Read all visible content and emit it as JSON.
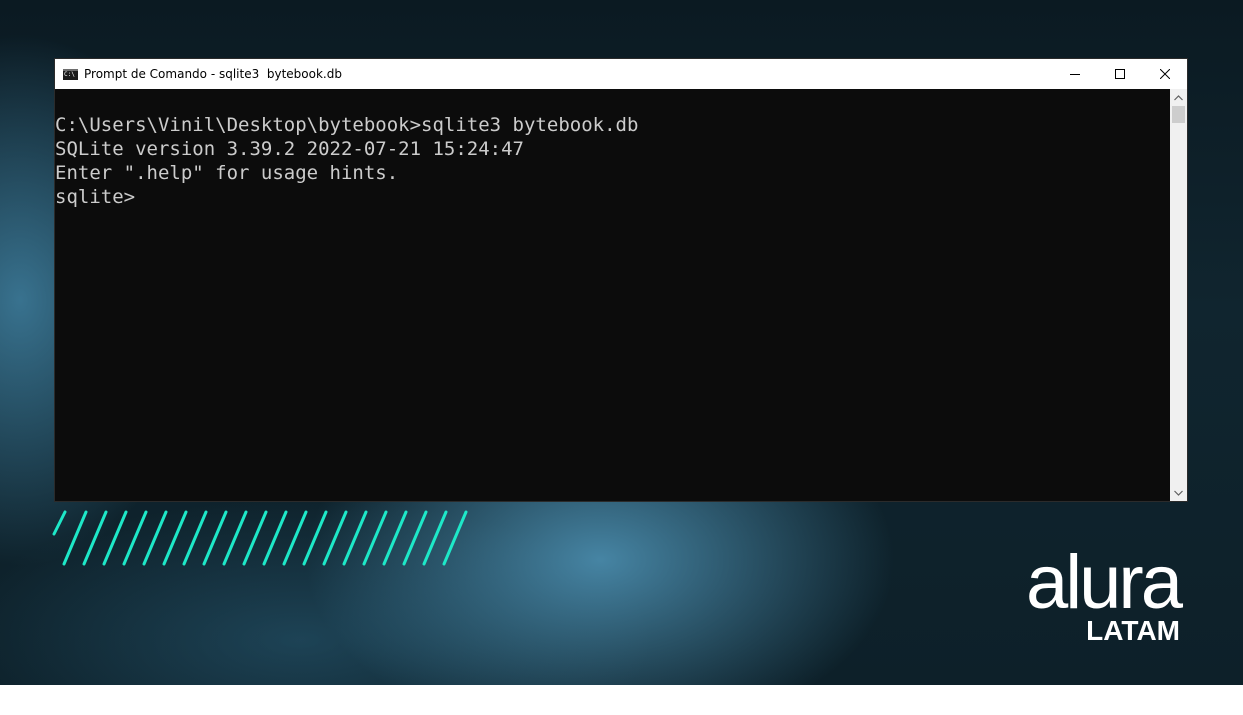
{
  "window": {
    "title": "Prompt de Comando - sqlite3  bytebook.db",
    "controls": {
      "minimize": "minimize-icon",
      "maximize": "maximize-icon",
      "close": "close-icon"
    }
  },
  "console": {
    "lines": [
      "C:\\Users\\Vinil\\Desktop\\bytebook>sqlite3 bytebook.db",
      "SQLite version 3.39.2 2022-07-21 15:24:47",
      "Enter \".help\" for usage hints.",
      "sqlite>"
    ],
    "text_color": "#cccccc",
    "background": "#0c0c0c"
  },
  "branding": {
    "logo_word": "alura",
    "logo_sub": "LATAM",
    "accent_color": "#1ee8c8"
  }
}
